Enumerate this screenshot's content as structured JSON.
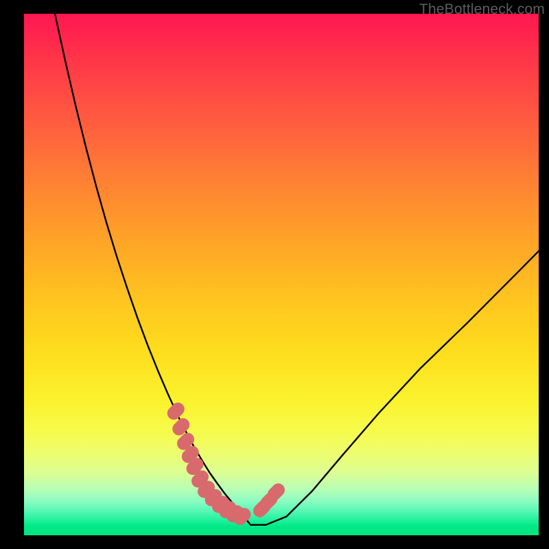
{
  "watermark": "TheBottleneck.com",
  "chart_data": {
    "type": "line",
    "title": "",
    "xlabel": "",
    "ylabel": "",
    "xlim": [
      0,
      100
    ],
    "ylim": [
      0,
      100
    ],
    "series": [
      {
        "name": "bottleneck-curve",
        "x": [
          6,
          8,
          10,
          12,
          14,
          16,
          18,
          20,
          22,
          24,
          26,
          28,
          30,
          31.5,
          33,
          34.5,
          36,
          37.5,
          39,
          40.5,
          42,
          44,
          47,
          51,
          56,
          62,
          69,
          77,
          86,
          96,
          100
        ],
        "y": [
          100,
          91,
          82.5,
          74.5,
          67,
          60,
          53.5,
          47.5,
          41.8,
          36.5,
          31.6,
          27,
          22.7,
          19.8,
          17,
          14.5,
          12.1,
          10,
          8,
          6.2,
          4.5,
          2,
          2,
          3.6,
          8.5,
          15.5,
          23.5,
          32,
          40.6,
          50.5,
          54.5
        ]
      }
    ],
    "marker_segments": [
      {
        "name": "left-marker",
        "x": [
          29.5,
          30.5,
          31.4,
          32.3,
          33.2
        ],
        "y": [
          23.8,
          20.8,
          18.0,
          15.5,
          13.2
        ]
      },
      {
        "name": "bottom-marker",
        "x": [
          34.2,
          35.4,
          36.8,
          38.2,
          39.6,
          41.0,
          42.4
        ],
        "y": [
          10.8,
          8.8,
          7.2,
          5.9,
          4.9,
          4.1,
          3.6
        ]
      },
      {
        "name": "right-marker",
        "x": [
          46.2,
          47.6,
          49.0
        ],
        "y": [
          5.1,
          6.6,
          8.3
        ]
      }
    ],
    "colors": {
      "curve": "#000000",
      "marker": "#d86a6e",
      "gradient_top": "#ff1751",
      "gradient_bottom": "#00e482"
    }
  }
}
